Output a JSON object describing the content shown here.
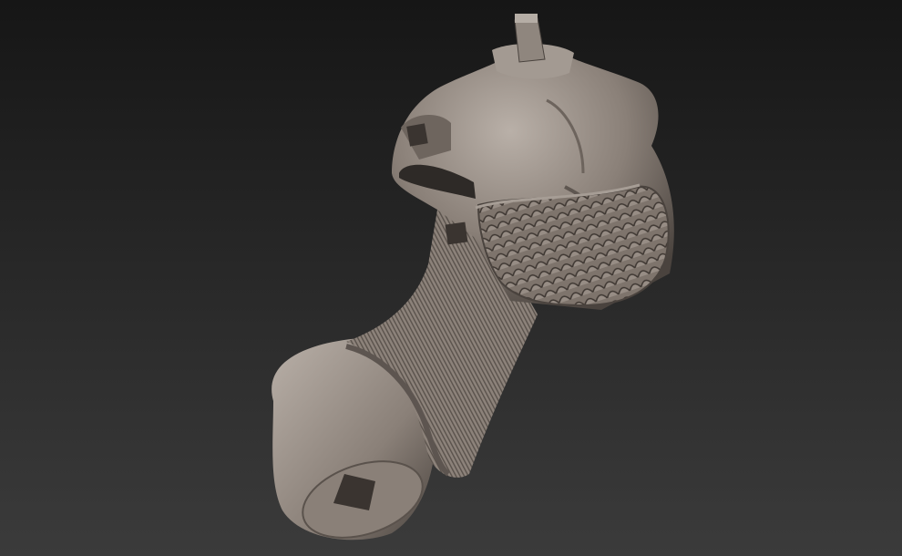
{
  "viewport": {
    "background_top": "#161616",
    "background_bottom": "#3b3b3b"
  },
  "model": {
    "material_base": "#8a8078",
    "material_light": "#b9b0a8",
    "material_dark": "#4a433e",
    "parts": [
      "neck-peg",
      "chest",
      "shoulder-socket",
      "scale-bodice",
      "ribbed-waist",
      "hip-block",
      "square-peg-socket"
    ]
  }
}
